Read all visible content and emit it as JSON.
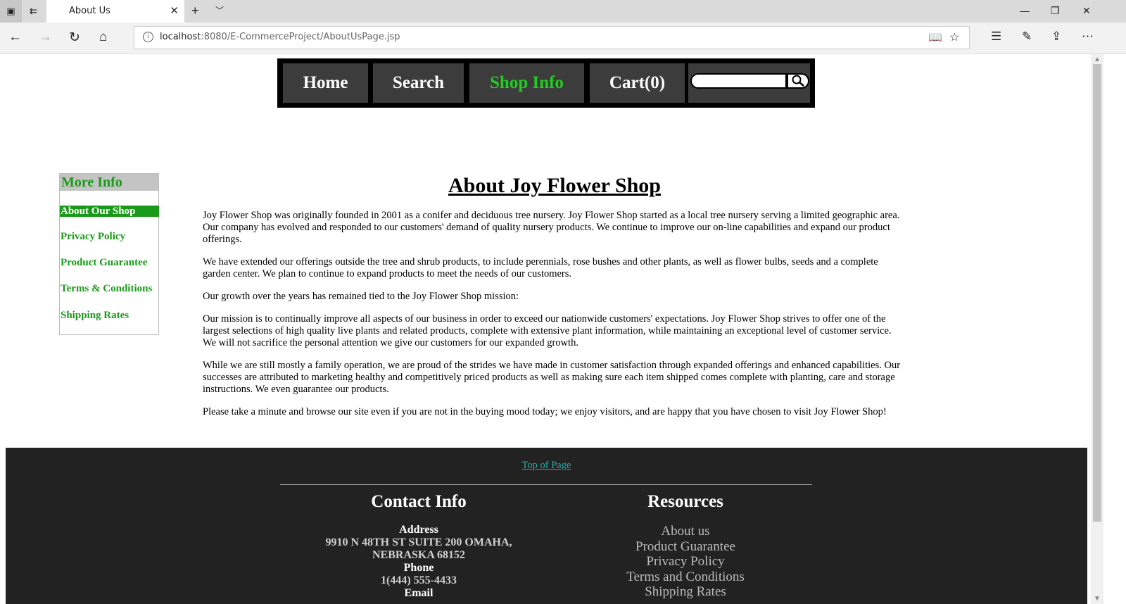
{
  "browser": {
    "tab_title": "About Us",
    "url_host": "localhost",
    "url_rest": ":8080/E-CommerceProject/AboutUsPage.jsp"
  },
  "nav": {
    "home": "Home",
    "search": "Search",
    "shop_info": "Shop Info",
    "cart": "Cart(0)",
    "search_value": "",
    "active_color": "#22cc22"
  },
  "sidebar": {
    "title": "More Info",
    "items": [
      {
        "label": "About Our Shop"
      },
      {
        "label": "Privacy Policy"
      },
      {
        "label": "Product Guarantee"
      },
      {
        "label": "Terms & Conditions"
      },
      {
        "label": "Shipping Rates"
      }
    ],
    "accent_color": "#1a9a1a"
  },
  "content": {
    "title": "About Joy Flower Shop",
    "paragraphs": [
      "Joy Flower Shop was originally founded in 2001 as a conifer and deciduous tree nursery. Joy Flower Shop started as a local tree nursery serving a limited geographic area. Our company has evolved and responded to our customers' demand of quality nursery products.  We continue to improve our on-line capabilities and expand our product offerings.",
      "We have extended our offerings outside the tree and shrub products, to include perennials, rose bushes and other plants, as well as flower bulbs, seeds and a complete garden center. We plan to continue to expand products to meet the needs of our customers.",
      "Our growth over the years has remained tied to the Joy Flower Shop mission:",
      "Our mission is to continually improve all aspects of our business in order to exceed our nationwide customers' expectations. Joy Flower Shop strives to offer one of the largest selections of high quality live plants and related products, complete with extensive plant information, while maintaining an exceptional level of customer service. We will not sacrifice the personal attention we give our customers for our expanded growth.",
      "While we are still mostly a family operation, we are proud of the strides we have made in customer satisfaction through expanded offerings and enhanced capabilities. Our successes are attributed to marketing healthy and competitively priced products as well as making sure each item shipped comes complete with planting, care and storage instructions. We even guarantee our products.",
      "Please take a minute and browse our site even if you are not in the buying mood today; we enjoy visitors, and are happy that you have chosen to visit Joy Flower Shop!"
    ]
  },
  "footer": {
    "top_link": "Top of Page",
    "contact_title": "Contact Info",
    "address_label": "Address",
    "address_line1": "9910 N 48TH ST SUITE 200 OMAHA,",
    "address_line2": "NEBRASKA 68152",
    "phone_label": "Phone",
    "phone": "1(444) 555-4433",
    "email_label": "Email",
    "resources_title": "Resources",
    "resources": [
      {
        "label": "About us"
      },
      {
        "label": "Product Guarantee"
      },
      {
        "label": "Privacy Policy"
      },
      {
        "label": "Terms and Conditions"
      },
      {
        "label": "Shipping Rates"
      }
    ],
    "link_color": "#20b2aa"
  }
}
